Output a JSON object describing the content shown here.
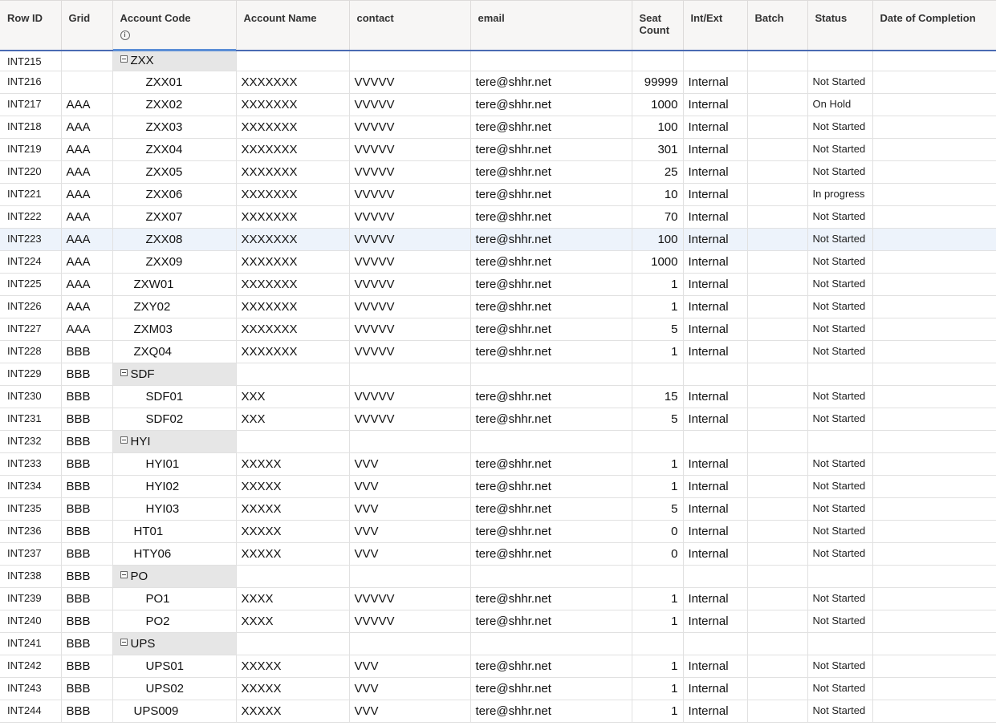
{
  "columns": [
    {
      "key": "row_id",
      "label": "Row ID"
    },
    {
      "key": "grid",
      "label": "Grid"
    },
    {
      "key": "account_code",
      "label": "Account Code"
    },
    {
      "key": "account_name",
      "label": "Account Name"
    },
    {
      "key": "contact",
      "label": "contact"
    },
    {
      "key": "email",
      "label": "email"
    },
    {
      "key": "seat_count",
      "label": "Seat Count"
    },
    {
      "key": "int_ext",
      "label": "Int/Ext"
    },
    {
      "key": "batch",
      "label": "Batch"
    },
    {
      "key": "status",
      "label": "Status"
    },
    {
      "key": "date_of_completion",
      "label": "Date of Completion"
    }
  ],
  "info_icon_glyph": "i",
  "selected_row_id": "INT223",
  "rows": [
    {
      "row_id": "INT215",
      "grid": "",
      "code": "ZXX",
      "group": true,
      "level": 0
    },
    {
      "row_id": "INT216",
      "grid": "",
      "code": "ZXX01",
      "level": 2,
      "name": "XXXXXXX",
      "contact": "VVVVV",
      "email": "tere@shhr.net",
      "seats": "99999",
      "intext": "Internal",
      "batch": "",
      "status": "Not Started",
      "date": ""
    },
    {
      "row_id": "INT217",
      "grid": "AAA",
      "code": "ZXX02",
      "level": 2,
      "name": "XXXXXXX",
      "contact": "VVVVV",
      "email": "tere@shhr.net",
      "seats": "1000",
      "intext": "Internal",
      "batch": "",
      "status": "On Hold",
      "date": ""
    },
    {
      "row_id": "INT218",
      "grid": "AAA",
      "code": "ZXX03",
      "level": 2,
      "name": "XXXXXXX",
      "contact": "VVVVV",
      "email": "tere@shhr.net",
      "seats": "100",
      "intext": "Internal",
      "batch": "",
      "status": "Not Started",
      "date": ""
    },
    {
      "row_id": "INT219",
      "grid": "AAA",
      "code": "ZXX04",
      "level": 2,
      "name": "XXXXXXX",
      "contact": "VVVVV",
      "email": "tere@shhr.net",
      "seats": "301",
      "intext": "Internal",
      "batch": "",
      "status": "Not Started",
      "date": ""
    },
    {
      "row_id": "INT220",
      "grid": "AAA",
      "code": "ZXX05",
      "level": 2,
      "name": "XXXXXXX",
      "contact": "VVVVV",
      "email": "tere@shhr.net",
      "seats": "25",
      "intext": "Internal",
      "batch": "",
      "status": "Not Started",
      "date": ""
    },
    {
      "row_id": "INT221",
      "grid": "AAA",
      "code": "ZXX06",
      "level": 2,
      "name": "XXXXXXX",
      "contact": "VVVVV",
      "email": "tere@shhr.net",
      "seats": "10",
      "intext": "Internal",
      "batch": "",
      "status": "In progress",
      "date": ""
    },
    {
      "row_id": "INT222",
      "grid": "AAA",
      "code": "ZXX07",
      "level": 2,
      "name": "XXXXXXX",
      "contact": "VVVVV",
      "email": "tere@shhr.net",
      "seats": "70",
      "intext": "Internal",
      "batch": "",
      "status": "Not Started",
      "date": ""
    },
    {
      "row_id": "INT223",
      "grid": "AAA",
      "code": "ZXX08",
      "level": 2,
      "name": "XXXXXXX",
      "contact": "VVVVV",
      "email": "tere@shhr.net",
      "seats": "100",
      "intext": "Internal",
      "batch": "",
      "status": "Not Started",
      "date": ""
    },
    {
      "row_id": "INT224",
      "grid": "AAA",
      "code": "ZXX09",
      "level": 2,
      "name": "XXXXXXX",
      "contact": "VVVVV",
      "email": "tere@shhr.net",
      "seats": "1000",
      "intext": "Internal",
      "batch": "",
      "status": "Not Started",
      "date": ""
    },
    {
      "row_id": "INT225",
      "grid": "AAA",
      "code": "ZXW01",
      "level": 1,
      "name": "XXXXXXX",
      "contact": "VVVVV",
      "email": "tere@shhr.net",
      "seats": "1",
      "intext": "Internal",
      "batch": "",
      "status": "Not Started",
      "date": ""
    },
    {
      "row_id": "INT226",
      "grid": "AAA",
      "code": "ZXY02",
      "level": 1,
      "name": "XXXXXXX",
      "contact": "VVVVV",
      "email": "tere@shhr.net",
      "seats": "1",
      "intext": "Internal",
      "batch": "",
      "status": "Not Started",
      "date": ""
    },
    {
      "row_id": "INT227",
      "grid": "AAA",
      "code": "ZXM03",
      "level": 1,
      "name": "XXXXXXX",
      "contact": "VVVVV",
      "email": "tere@shhr.net",
      "seats": "5",
      "intext": "Internal",
      "batch": "",
      "status": "Not Started",
      "date": ""
    },
    {
      "row_id": "INT228",
      "grid": "BBB",
      "code": "ZXQ04",
      "level": 1,
      "name": "XXXXXXX",
      "contact": "VVVVV",
      "email": "tere@shhr.net",
      "seats": "1",
      "intext": "Internal",
      "batch": "",
      "status": "Not Started",
      "date": ""
    },
    {
      "row_id": "INT229",
      "grid": "BBB",
      "code": "SDF",
      "group": true,
      "level": 0
    },
    {
      "row_id": "INT230",
      "grid": "BBB",
      "code": "SDF01",
      "level": 2,
      "name": "XXX",
      "contact": "VVVVV",
      "email": "tere@shhr.net",
      "seats": "15",
      "intext": "Internal",
      "batch": "",
      "status": "Not Started",
      "date": ""
    },
    {
      "row_id": "INT231",
      "grid": "BBB",
      "code": "SDF02",
      "level": 2,
      "name": "XXX",
      "contact": "VVVVV",
      "email": "tere@shhr.net",
      "seats": "5",
      "intext": "Internal",
      "batch": "",
      "status": "Not Started",
      "date": ""
    },
    {
      "row_id": "INT232",
      "grid": "BBB",
      "code": "HYI",
      "group": true,
      "level": 0
    },
    {
      "row_id": "INT233",
      "grid": "BBB",
      "code": "HYI01",
      "level": 2,
      "name": "XXXXX",
      "contact": "VVV",
      "email": "tere@shhr.net",
      "seats": "1",
      "intext": "Internal",
      "batch": "",
      "status": "Not Started",
      "date": ""
    },
    {
      "row_id": "INT234",
      "grid": "BBB",
      "code": "HYI02",
      "level": 2,
      "name": "XXXXX",
      "contact": "VVV",
      "email": "tere@shhr.net",
      "seats": "1",
      "intext": "Internal",
      "batch": "",
      "status": "Not Started",
      "date": ""
    },
    {
      "row_id": "INT235",
      "grid": "BBB",
      "code": "HYI03",
      "level": 2,
      "name": "XXXXX",
      "contact": "VVV",
      "email": "tere@shhr.net",
      "seats": "5",
      "intext": "Internal",
      "batch": "",
      "status": "Not Started",
      "date": ""
    },
    {
      "row_id": "INT236",
      "grid": "BBB",
      "code": "HT01",
      "level": 1,
      "name": "XXXXX",
      "contact": "VVV",
      "email": "tere@shhr.net",
      "seats": "0",
      "intext": "Internal",
      "batch": "",
      "status": "Not Started",
      "date": ""
    },
    {
      "row_id": "INT237",
      "grid": "BBB",
      "code": "HTY06",
      "level": 1,
      "name": "XXXXX",
      "contact": "VVV",
      "email": "tere@shhr.net",
      "seats": "0",
      "intext": "Internal",
      "batch": "",
      "status": "Not Started",
      "date": ""
    },
    {
      "row_id": "INT238",
      "grid": "BBB",
      "code": "PO",
      "group": true,
      "level": 0
    },
    {
      "row_id": "INT239",
      "grid": "BBB",
      "code": "PO1",
      "level": 2,
      "name": "XXXX",
      "contact": "VVVVV",
      "email": "tere@shhr.net",
      "seats": "1",
      "intext": "Internal",
      "batch": "",
      "status": "Not Started",
      "date": ""
    },
    {
      "row_id": "INT240",
      "grid": "BBB",
      "code": "PO2",
      "level": 2,
      "name": "XXXX",
      "contact": "VVVVV",
      "email": "tere@shhr.net",
      "seats": "1",
      "intext": "Internal",
      "batch": "",
      "status": "Not Started",
      "date": ""
    },
    {
      "row_id": "INT241",
      "grid": "BBB",
      "code": "UPS",
      "group": true,
      "level": 0
    },
    {
      "row_id": "INT242",
      "grid": "BBB",
      "code": "UPS01",
      "level": 2,
      "name": "XXXXX",
      "contact": "VVV",
      "email": "tere@shhr.net",
      "seats": "1",
      "intext": "Internal",
      "batch": "",
      "status": "Not Started",
      "date": ""
    },
    {
      "row_id": "INT243",
      "grid": "BBB",
      "code": "UPS02",
      "level": 2,
      "name": "XXXXX",
      "contact": "VVV",
      "email": "tere@shhr.net",
      "seats": "1",
      "intext": "Internal",
      "batch": "",
      "status": "Not Started",
      "date": ""
    },
    {
      "row_id": "INT244",
      "grid": "BBB",
      "code": "UPS009",
      "level": 1,
      "name": "XXXXX",
      "contact": "VVV",
      "email": "tere@shhr.net",
      "seats": "1",
      "intext": "Internal",
      "batch": "",
      "status": "Not Started",
      "date": ""
    }
  ]
}
